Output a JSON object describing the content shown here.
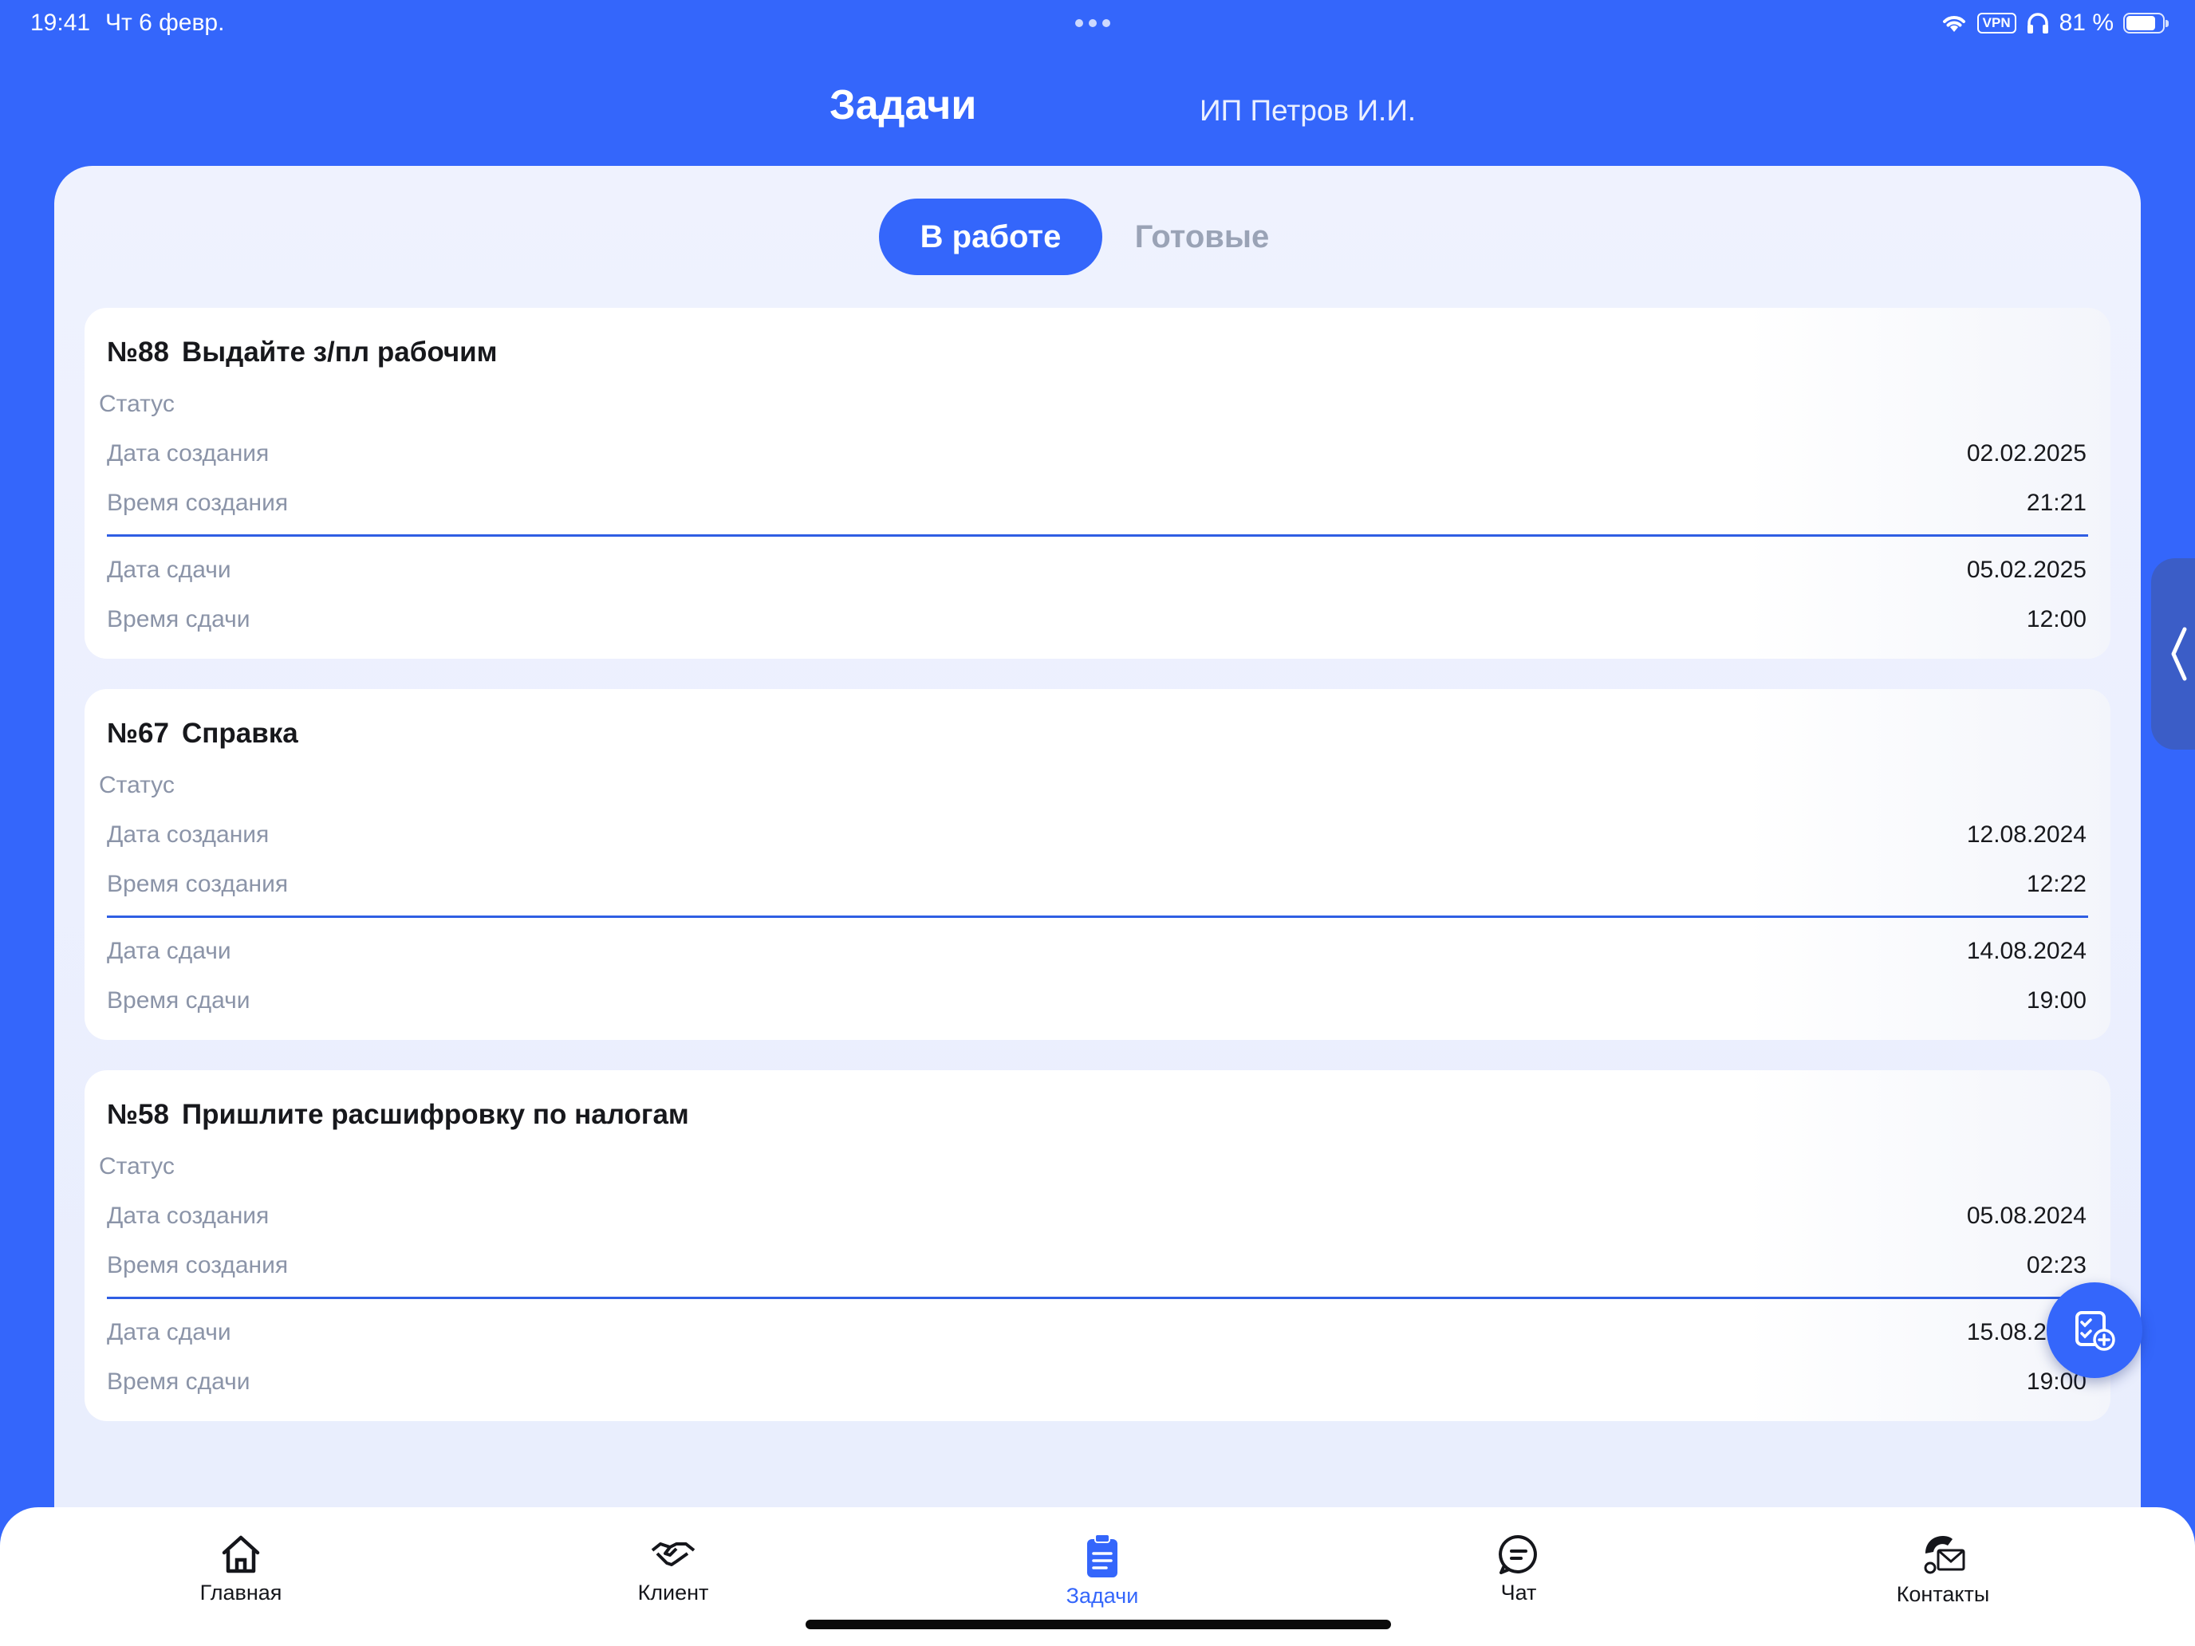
{
  "status_bar": {
    "time": "19:41",
    "date": "Чт 6 февр.",
    "vpn": "VPN",
    "battery": "81 %",
    "battery_level": 0.81
  },
  "header": {
    "title": "Задачи",
    "client": "ИП Петров И.И."
  },
  "segments": {
    "active": "В работе",
    "inactive": "Готовые"
  },
  "labels": {
    "status": "Статус",
    "created_date": "Дата создания",
    "created_time": "Время создания",
    "due_date": "Дата сдачи",
    "due_time": "Время сдачи"
  },
  "tasks": [
    {
      "number": "№88",
      "title": "Выдайте з/пл рабочим",
      "created_date": "02.02.2025",
      "created_time": "21:21",
      "due_date": "05.02.2025",
      "due_time": "12:00"
    },
    {
      "number": "№67",
      "title": "Справка",
      "created_date": "12.08.2024",
      "created_time": "12:22",
      "due_date": "14.08.2024",
      "due_time": "19:00"
    },
    {
      "number": "№58",
      "title": "Пришлите расшифровку по налогам",
      "created_date": "05.08.2024",
      "created_time": "02:23",
      "due_date": "15.08.2024",
      "due_time": "19:00"
    }
  ],
  "nav": {
    "home": "Главная",
    "client": "Клиент",
    "tasks": "Задачи",
    "chat": "Чат",
    "contacts": "Контакты"
  },
  "colors": {
    "accent": "#3466fb",
    "panel": "#eff2fe",
    "muted_text": "#8b94a8",
    "divider": "#2f5ee3"
  },
  "icons": {
    "home": "home-icon",
    "client": "handshake-icon",
    "tasks": "clipboard-icon",
    "chat": "chat-bubble-icon",
    "contacts": "phone-envelope-icon",
    "fab": "add-task-icon",
    "side_handle": "chevron-left-icon"
  }
}
